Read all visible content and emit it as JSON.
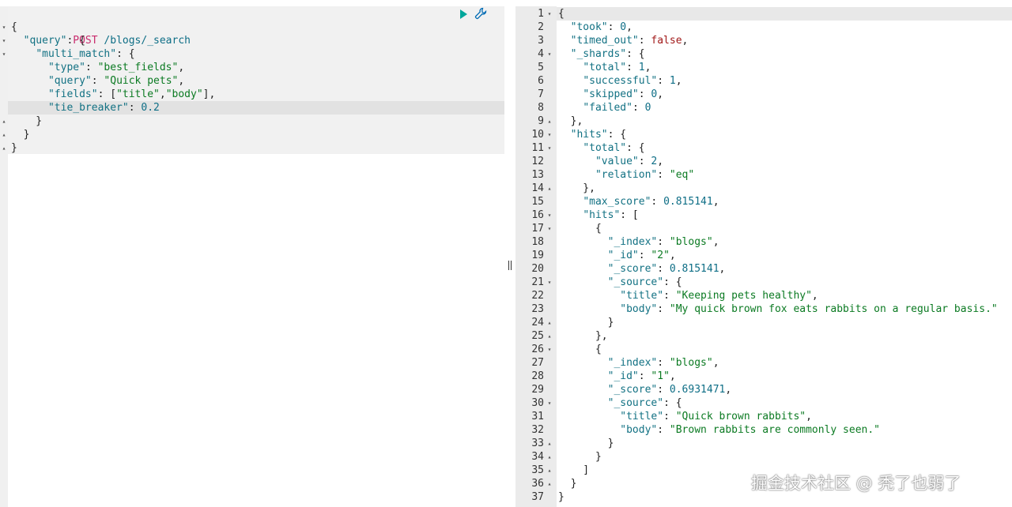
{
  "request": {
    "method": "POST",
    "path": " /blogs/_search",
    "lines": [
      {
        "fold": "▾",
        "parts": [
          [
            "p",
            "{"
          ]
        ]
      },
      {
        "fold": "▾",
        "parts": [
          [
            "p",
            "  "
          ],
          [
            "k",
            "\"query\""
          ],
          [
            "p",
            ": {"
          ]
        ]
      },
      {
        "fold": "▾",
        "parts": [
          [
            "p",
            "    "
          ],
          [
            "k",
            "\"multi_match\""
          ],
          [
            "p",
            ": {"
          ]
        ]
      },
      {
        "fold": "",
        "parts": [
          [
            "p",
            "      "
          ],
          [
            "k",
            "\"type\""
          ],
          [
            "p",
            ": "
          ],
          [
            "s",
            "\"best_fields\""
          ],
          [
            "p",
            ","
          ]
        ]
      },
      {
        "fold": "",
        "parts": [
          [
            "p",
            "      "
          ],
          [
            "k",
            "\"query\""
          ],
          [
            "p",
            ": "
          ],
          [
            "s",
            "\"Quick pets\""
          ],
          [
            "p",
            ","
          ]
        ]
      },
      {
        "fold": "",
        "parts": [
          [
            "p",
            "      "
          ],
          [
            "k",
            "\"fields\""
          ],
          [
            "p",
            ": ["
          ],
          [
            "s",
            "\"title\""
          ],
          [
            "p",
            ","
          ],
          [
            "s",
            "\"body\""
          ],
          [
            "p",
            "],"
          ]
        ]
      },
      {
        "fold": "",
        "parts": [
          [
            "p",
            "      "
          ],
          [
            "k",
            "\"tie_breaker\""
          ],
          [
            "p",
            ": "
          ],
          [
            "n",
            "0.2"
          ]
        ]
      },
      {
        "fold": "▴",
        "parts": [
          [
            "p",
            "    }"
          ]
        ]
      },
      {
        "fold": "▴",
        "parts": [
          [
            "p",
            "  }"
          ]
        ]
      },
      {
        "fold": "▴",
        "parts": [
          [
            "p",
            "}"
          ]
        ]
      }
    ]
  },
  "actions": {
    "run_label": "Run",
    "settings_label": "Settings"
  },
  "response": {
    "lines": [
      {
        "fold": "▾",
        "parts": [
          [
            "p",
            "{"
          ]
        ]
      },
      {
        "fold": "",
        "parts": [
          [
            "p",
            "  "
          ],
          [
            "k",
            "\"took\""
          ],
          [
            "p",
            ": "
          ],
          [
            "n",
            "0"
          ],
          [
            "p",
            ","
          ]
        ]
      },
      {
        "fold": "",
        "parts": [
          [
            "p",
            "  "
          ],
          [
            "k",
            "\"timed_out\""
          ],
          [
            "p",
            ": "
          ],
          [
            "b",
            "false"
          ],
          [
            "p",
            ","
          ]
        ]
      },
      {
        "fold": "▾",
        "parts": [
          [
            "p",
            "  "
          ],
          [
            "k",
            "\"_shards\""
          ],
          [
            "p",
            ": {"
          ]
        ]
      },
      {
        "fold": "",
        "parts": [
          [
            "p",
            "    "
          ],
          [
            "k",
            "\"total\""
          ],
          [
            "p",
            ": "
          ],
          [
            "n",
            "1"
          ],
          [
            "p",
            ","
          ]
        ]
      },
      {
        "fold": "",
        "parts": [
          [
            "p",
            "    "
          ],
          [
            "k",
            "\"successful\""
          ],
          [
            "p",
            ": "
          ],
          [
            "n",
            "1"
          ],
          [
            "p",
            ","
          ]
        ]
      },
      {
        "fold": "",
        "parts": [
          [
            "p",
            "    "
          ],
          [
            "k",
            "\"skipped\""
          ],
          [
            "p",
            ": "
          ],
          [
            "n",
            "0"
          ],
          [
            "p",
            ","
          ]
        ]
      },
      {
        "fold": "",
        "parts": [
          [
            "p",
            "    "
          ],
          [
            "k",
            "\"failed\""
          ],
          [
            "p",
            ": "
          ],
          [
            "n",
            "0"
          ]
        ]
      },
      {
        "fold": "▴",
        "parts": [
          [
            "p",
            "  },"
          ]
        ]
      },
      {
        "fold": "▾",
        "parts": [
          [
            "p",
            "  "
          ],
          [
            "k",
            "\"hits\""
          ],
          [
            "p",
            ": {"
          ]
        ]
      },
      {
        "fold": "▾",
        "parts": [
          [
            "p",
            "    "
          ],
          [
            "k",
            "\"total\""
          ],
          [
            "p",
            ": {"
          ]
        ]
      },
      {
        "fold": "",
        "parts": [
          [
            "p",
            "      "
          ],
          [
            "k",
            "\"value\""
          ],
          [
            "p",
            ": "
          ],
          [
            "n",
            "2"
          ],
          [
            "p",
            ","
          ]
        ]
      },
      {
        "fold": "",
        "parts": [
          [
            "p",
            "      "
          ],
          [
            "k",
            "\"relation\""
          ],
          [
            "p",
            ": "
          ],
          [
            "s",
            "\"eq\""
          ]
        ]
      },
      {
        "fold": "▴",
        "parts": [
          [
            "p",
            "    },"
          ]
        ]
      },
      {
        "fold": "",
        "parts": [
          [
            "p",
            "    "
          ],
          [
            "k",
            "\"max_score\""
          ],
          [
            "p",
            ": "
          ],
          [
            "n",
            "0.815141"
          ],
          [
            "p",
            ","
          ]
        ]
      },
      {
        "fold": "▾",
        "parts": [
          [
            "p",
            "    "
          ],
          [
            "k",
            "\"hits\""
          ],
          [
            "p",
            ": ["
          ]
        ]
      },
      {
        "fold": "▾",
        "parts": [
          [
            "p",
            "      {"
          ]
        ]
      },
      {
        "fold": "",
        "parts": [
          [
            "p",
            "        "
          ],
          [
            "k",
            "\"_index\""
          ],
          [
            "p",
            ": "
          ],
          [
            "s",
            "\"blogs\""
          ],
          [
            "p",
            ","
          ]
        ]
      },
      {
        "fold": "",
        "parts": [
          [
            "p",
            "        "
          ],
          [
            "k",
            "\"_id\""
          ],
          [
            "p",
            ": "
          ],
          [
            "s",
            "\"2\""
          ],
          [
            "p",
            ","
          ]
        ]
      },
      {
        "fold": "",
        "parts": [
          [
            "p",
            "        "
          ],
          [
            "k",
            "\"_score\""
          ],
          [
            "p",
            ": "
          ],
          [
            "n",
            "0.815141"
          ],
          [
            "p",
            ","
          ]
        ]
      },
      {
        "fold": "▾",
        "parts": [
          [
            "p",
            "        "
          ],
          [
            "k",
            "\"_source\""
          ],
          [
            "p",
            ": {"
          ]
        ]
      },
      {
        "fold": "",
        "parts": [
          [
            "p",
            "          "
          ],
          [
            "k",
            "\"title\""
          ],
          [
            "p",
            ": "
          ],
          [
            "s",
            "\"Keeping pets healthy\""
          ],
          [
            "p",
            ","
          ]
        ]
      },
      {
        "fold": "",
        "parts": [
          [
            "p",
            "          "
          ],
          [
            "k",
            "\"body\""
          ],
          [
            "p",
            ": "
          ],
          [
            "s",
            "\"My quick brown fox eats rabbits on a regular basis.\""
          ]
        ]
      },
      {
        "fold": "▴",
        "parts": [
          [
            "p",
            "        }"
          ]
        ]
      },
      {
        "fold": "▴",
        "parts": [
          [
            "p",
            "      },"
          ]
        ]
      },
      {
        "fold": "▾",
        "parts": [
          [
            "p",
            "      {"
          ]
        ]
      },
      {
        "fold": "",
        "parts": [
          [
            "p",
            "        "
          ],
          [
            "k",
            "\"_index\""
          ],
          [
            "p",
            ": "
          ],
          [
            "s",
            "\"blogs\""
          ],
          [
            "p",
            ","
          ]
        ]
      },
      {
        "fold": "",
        "parts": [
          [
            "p",
            "        "
          ],
          [
            "k",
            "\"_id\""
          ],
          [
            "p",
            ": "
          ],
          [
            "s",
            "\"1\""
          ],
          [
            "p",
            ","
          ]
        ]
      },
      {
        "fold": "",
        "parts": [
          [
            "p",
            "        "
          ],
          [
            "k",
            "\"_score\""
          ],
          [
            "p",
            ": "
          ],
          [
            "n",
            "0.6931471"
          ],
          [
            "p",
            ","
          ]
        ]
      },
      {
        "fold": "▾",
        "parts": [
          [
            "p",
            "        "
          ],
          [
            "k",
            "\"_source\""
          ],
          [
            "p",
            ": {"
          ]
        ]
      },
      {
        "fold": "",
        "parts": [
          [
            "p",
            "          "
          ],
          [
            "k",
            "\"title\""
          ],
          [
            "p",
            ": "
          ],
          [
            "s",
            "\"Quick brown rabbits\""
          ],
          [
            "p",
            ","
          ]
        ]
      },
      {
        "fold": "",
        "parts": [
          [
            "p",
            "          "
          ],
          [
            "k",
            "\"body\""
          ],
          [
            "p",
            ": "
          ],
          [
            "s",
            "\"Brown rabbits are commonly seen.\""
          ]
        ]
      },
      {
        "fold": "▴",
        "parts": [
          [
            "p",
            "        }"
          ]
        ]
      },
      {
        "fold": "▴",
        "parts": [
          [
            "p",
            "      }"
          ]
        ]
      },
      {
        "fold": "▴",
        "parts": [
          [
            "p",
            "    ]"
          ]
        ]
      },
      {
        "fold": "▴",
        "parts": [
          [
            "p",
            "  }"
          ]
        ]
      },
      {
        "fold": "",
        "parts": [
          [
            "p",
            "}"
          ]
        ]
      }
    ]
  },
  "watermark": "掘金技术社区 @ 秃了也弱了",
  "colors": {
    "key": "#127183",
    "string": "#0b7a22",
    "number": "#0e6e86",
    "boolean": "#a11818",
    "method": "#c92b6d",
    "run": "#00a69b",
    "settings": "#006bb4"
  }
}
